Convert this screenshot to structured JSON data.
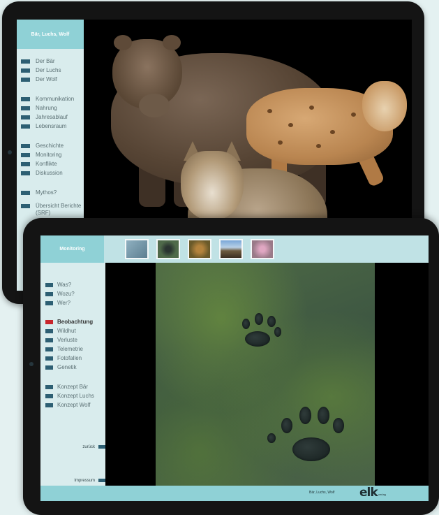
{
  "tablet_top": {
    "title": "Bär, Luchs, Wolf",
    "menu": [
      {
        "label": "Der Bär"
      },
      {
        "label": "Der Luchs"
      },
      {
        "label": "Der Wolf"
      },
      {
        "label": "Kommunikation"
      },
      {
        "label": "Nahrung"
      },
      {
        "label": "Jahresablauf"
      },
      {
        "label": "Lebensraum"
      },
      {
        "label": "Geschichte"
      },
      {
        "label": "Monitoring"
      },
      {
        "label": "Konflikte"
      },
      {
        "label": "Diskussion"
      },
      {
        "label": "Mythos?"
      },
      {
        "label": "Übersicht Berichte (SRF)"
      }
    ]
  },
  "tablet_front": {
    "title": "Monitoring",
    "menu": [
      {
        "label": "Was?"
      },
      {
        "label": "Wozu?"
      },
      {
        "label": "Wer?"
      },
      {
        "label": "Beobachtung",
        "active": true
      },
      {
        "label": "Wildhut"
      },
      {
        "label": "Verluste"
      },
      {
        "label": "Telemetrie"
      },
      {
        "label": "Fotofallen"
      },
      {
        "label": "Genetik"
      },
      {
        "label": "Konzept Bär"
      },
      {
        "label": "Konzept Luchs"
      },
      {
        "label": "Konzept Wolf"
      }
    ],
    "back_label": "zurück",
    "impressum_label": "Impressum",
    "footer_text": "Bär, Luchs, Wolf",
    "logo_text": "elk",
    "logo_sub": "verlag"
  },
  "colors": {
    "accent": "#8fd1d6",
    "sidebar": "#d9eced",
    "marker": "#2d5f73",
    "active_marker": "#c7252b"
  }
}
